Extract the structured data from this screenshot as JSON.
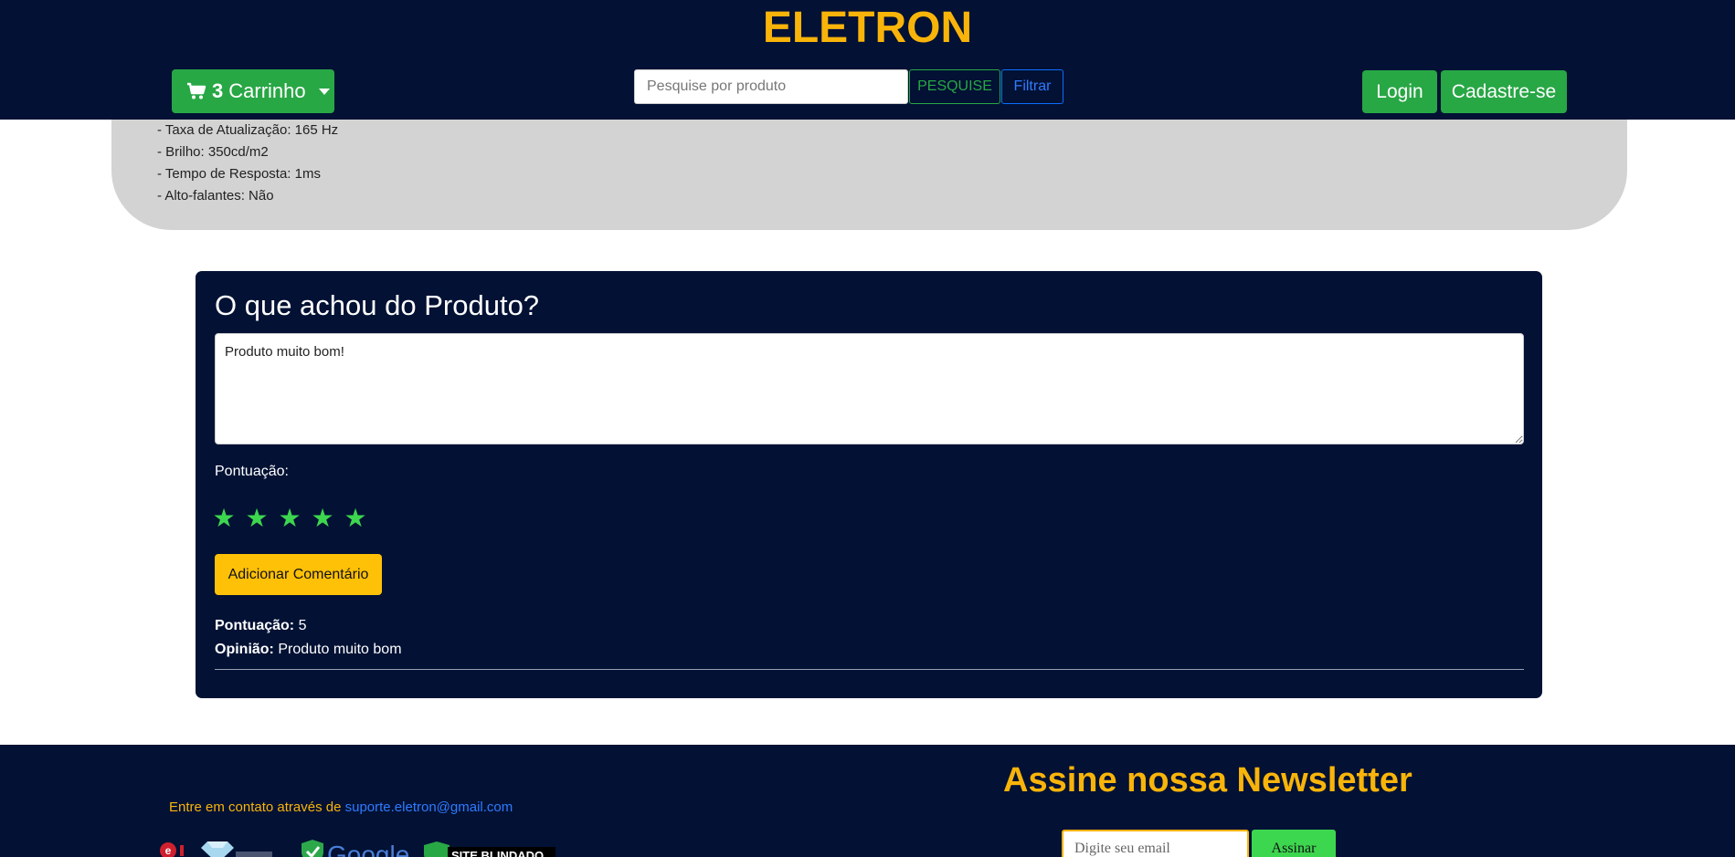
{
  "header": {
    "brand": "ELETRON",
    "cart": {
      "count": "3",
      "label": "Carrinho"
    },
    "search": {
      "placeholder": "Pesquise por produto",
      "search_label": "PESQUISE",
      "filter_label": "Filtrar"
    },
    "login_label": "Login",
    "signup_label": "Cadastre-se"
  },
  "specs": [
    "- Taxa de Atualização: 165 Hz",
    "- Brilho: 350cd/m2",
    "- Tempo de Resposta: 1ms",
    "- Alto-falantes: Não"
  ],
  "review_form": {
    "title": "O que achou do Produto?",
    "comment_value": "Produto muito bom!",
    "score_label": "Pontuação:",
    "stars": [
      "★",
      "★",
      "★",
      "★",
      "★"
    ],
    "rating": 5,
    "submit_label": "Adicionar Comentário"
  },
  "comments": [
    {
      "score_label": "Pontuação:",
      "score": "5",
      "opinion_label": "Opinião:",
      "opinion": "Produto muito bom"
    }
  ],
  "footer": {
    "contact_text": "Entre em contato através de",
    "contact_email": "suporte.eletron@gmail.com",
    "seal_google": "Google",
    "seal_site_blindado": "SITE BLINDADO",
    "newsletter_title": "Assine nossa Newsletter",
    "email_placeholder": "Digite seu email",
    "subscribe_label": "Assinar"
  },
  "colors": {
    "navy": "#021134",
    "brand_yellow": "#f9b40a",
    "green": "#28a745",
    "star_green": "#3dd64f",
    "button_yellow": "#ffc107",
    "spec_gray": "#d3d3d3"
  }
}
